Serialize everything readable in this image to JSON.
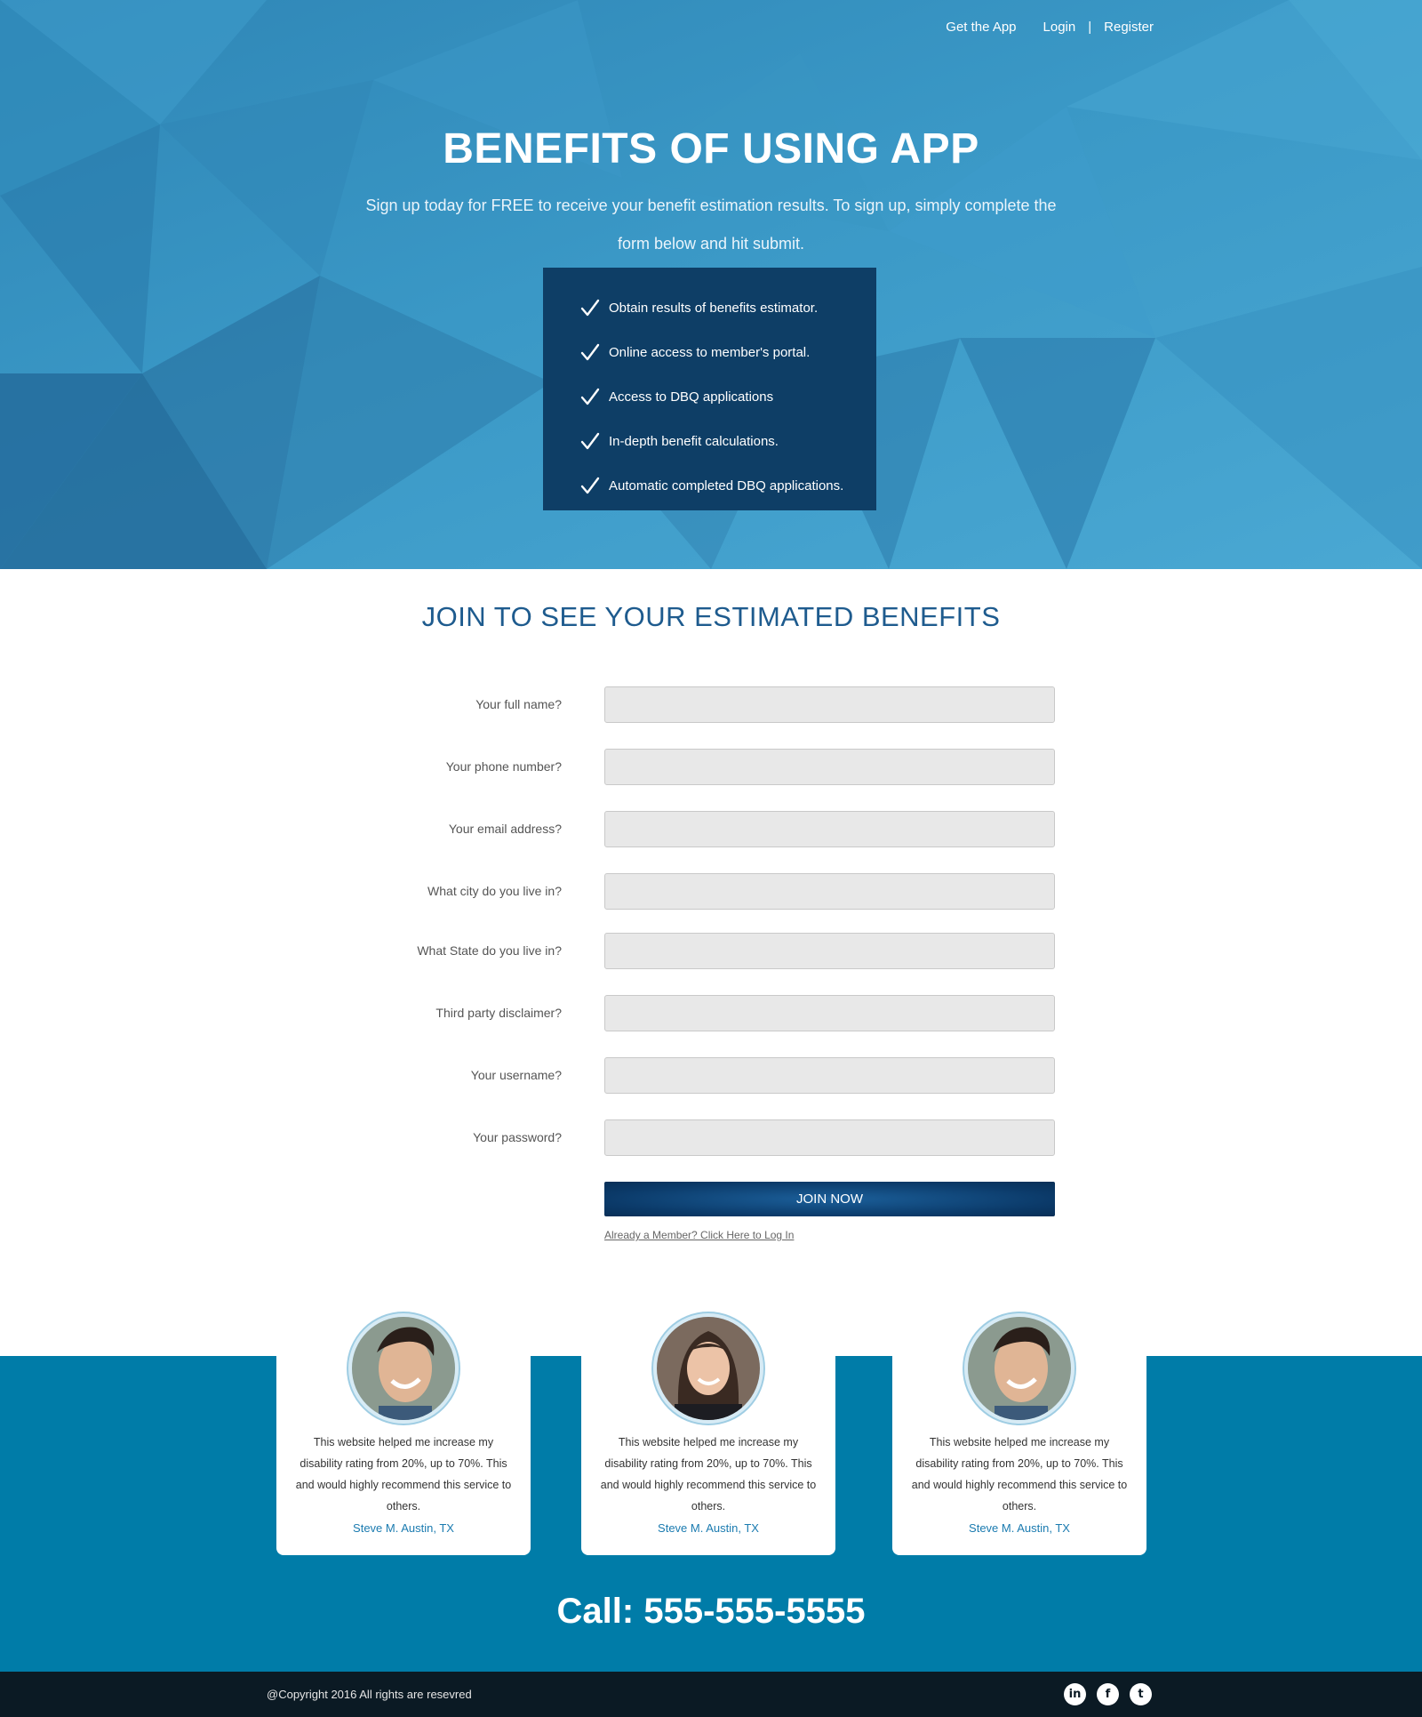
{
  "nav": {
    "get_app": "Get the App",
    "login": "Login",
    "separator": "|",
    "register": "Register"
  },
  "hero": {
    "title": "BENEFITS OF USING APP",
    "subtitle": "Sign up today for FREE to receive your benefit estimation results. To sign up, simply complete the form below and hit submit.",
    "benefits": [
      "Obtain results of benefits estimator.",
      "Online access to member's portal.",
      "Access to DBQ applications",
      "In-depth benefit calculations.",
      "Automatic completed DBQ applications."
    ]
  },
  "form": {
    "title": "JOIN TO SEE YOUR ESTIMATED BENEFITS",
    "fields": [
      {
        "label": "Your full name?",
        "value": ""
      },
      {
        "label": "Your phone number?",
        "value": ""
      },
      {
        "label": "Your email address?",
        "value": ""
      },
      {
        "label": "What city do you live in?",
        "value": ""
      },
      {
        "label": "What State do you live in?",
        "value": ""
      },
      {
        "label": "Third party disclaimer?",
        "value": ""
      },
      {
        "label": "Your username?",
        "value": ""
      },
      {
        "label": "Your password?",
        "value": ""
      }
    ],
    "submit_label": "JOIN NOW",
    "login_link": "Already a Member? Click Here to Log In"
  },
  "testimonials": [
    {
      "quote": "This website helped me increase my disability rating from 20%, up to 70%. This and would highly recommend this service to others.",
      "author": "Steve M. Austin, TX",
      "avatar": "smiling-man-photo"
    },
    {
      "quote": "This website helped me increase my disability rating from 20%, up to 70%. This and would highly recommend this service to others.",
      "author": "Steve M. Austin, TX",
      "avatar": "smiling-woman-photo"
    },
    {
      "quote": "This website helped me increase my disability rating from 20%, up to 70%. This and would highly recommend this service to others.",
      "author": "Steve M. Austin, TX",
      "avatar": "smiling-man-photo"
    }
  ],
  "call": "Call: 555-555-5555",
  "footer": {
    "copyright": "@Copyright 2016 All rights are resevred",
    "social": [
      {
        "icon": "linkedin-icon",
        "glyph": "in"
      },
      {
        "icon": "facebook-icon",
        "glyph": "f"
      },
      {
        "icon": "twitter-icon",
        "glyph": "t"
      }
    ]
  },
  "colors": {
    "hero_blue": "#3a98c6",
    "benefits_box": "#0e3e66",
    "title_blue": "#1e5b8e",
    "band_blue": "#007ca8",
    "button_navy": "#0b3a69",
    "footer": "#0b1a24"
  }
}
